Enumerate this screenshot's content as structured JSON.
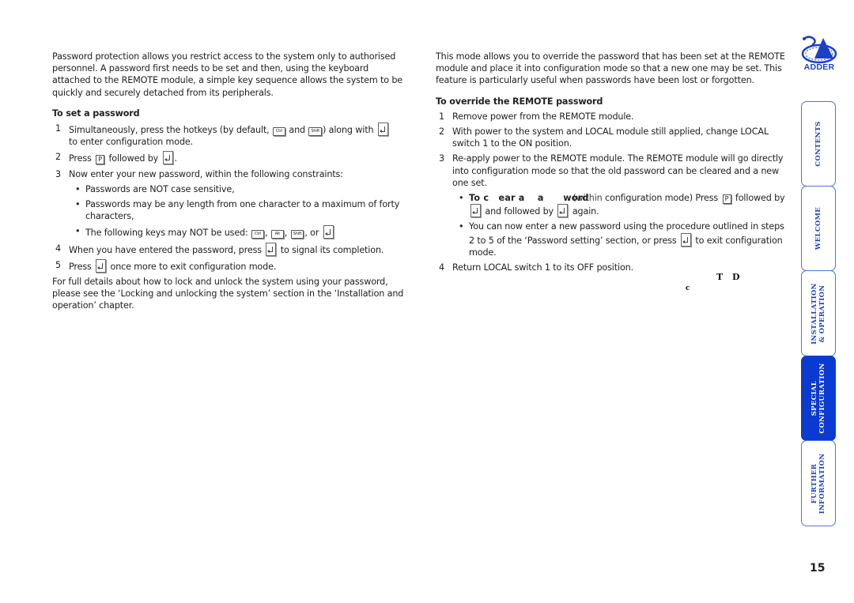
{
  "left_column": {
    "intro": "Password protection allows you restrict access to the system only to authorised personnel. A password first needs to be set and then, using the keyboard attached to the REMOTE module, a simple key sequence allows the system to be quickly and securely detached from its peripherals.",
    "heading": "To set a password",
    "steps": [
      {
        "n": "1",
        "a": "Simultaneously, press the hotkeys (by default, ",
        "key1": "Ctrl",
        "b": " and ",
        "key2": "Shift",
        "c": ") along with ",
        "d": " to enter configuration mode."
      },
      {
        "n": "2",
        "a": "Press ",
        "keyP": "P",
        "b": " followed by ",
        "c": "."
      },
      {
        "n": "3",
        "a": "Now enter your new password, within the following constraints:"
      },
      {
        "n": "4",
        "a": "When you have entered the password, press ",
        "b": " to signal its completion."
      },
      {
        "n": "5",
        "a": "Press ",
        "b": " once more to exit configuration mode."
      }
    ],
    "constraints": [
      "Passwords are NOT case sensitive,",
      "Passwords may be any length from one character to a maximum of forty characters,",
      {
        "a": "The following keys may NOT be used: ",
        "k1": "Ctrl",
        "k2": "Alt",
        "k3": "Shift",
        "sep": ", ",
        "or": ", or "
      }
    ],
    "footer": "For full details about how to lock and unlock the system using your password, please see the ‘Locking and unlocking the system’ section in the ‘Installation and operation’ chapter."
  },
  "right_column": {
    "intro": "This mode allows you to override the password that has been set at the REMOTE module and place it into configuration mode so that a new one may be set. This feature is particularly useful when passwords have been lost or forgotten.",
    "heading": "To override the REMOTE password",
    "steps": [
      {
        "n": "1",
        "a": "Remove power from the REMOTE module."
      },
      {
        "n": "2",
        "a": "With power to the system and LOCAL module still applied, change LOCAL switch 1 to the ON position."
      },
      {
        "n": "3",
        "a": "Re-apply power to the REMOTE module. The REMOTE module will go directly into configuration mode so that the old password can be cleared and a new one set."
      },
      {
        "n": "4",
        "a": "Return LOCAL switch 1 to its OFF position."
      }
    ],
    "bullets": [
      {
        "bold": "To c   ear a    a      word",
        "under": "(within",
        "a": " configuration mode) Press ",
        "keyP": "P",
        "b": " followed by ",
        "c": " and followed by ",
        "d": " again."
      },
      {
        "a": "You can now enter a new password using the procedure outlined in steps 2 to 5 of the ‘Password setting’ section, or press ",
        "b": " to exit configuration mode."
      }
    ],
    "stray_glyphs": [
      "T",
      "D",
      "c"
    ]
  },
  "logo": {
    "text": "ADDER",
    "color": "#1c3fc8"
  },
  "nav_tabs": [
    {
      "label": "CONTENTS",
      "active": false
    },
    {
      "label": "WELCOME",
      "active": false
    },
    {
      "label": "INSTALLATION\n& OPERATION",
      "line1": "INSTALLATION",
      "line2": "& OPERATION",
      "active": false
    },
    {
      "label": "SPECIAL CONFIGURATION",
      "line1": "SPECIAL",
      "line2": "CONFIGURATION",
      "active": true
    },
    {
      "label": "FURTHER INFORMATION",
      "line1": "FURTHER",
      "line2": "INFORMATION",
      "active": false
    }
  ],
  "colors": {
    "tab_border": "#4a78dc",
    "tab_active": "#0b3ad0",
    "tab_text": "#1d43c6"
  },
  "page_number": "15"
}
